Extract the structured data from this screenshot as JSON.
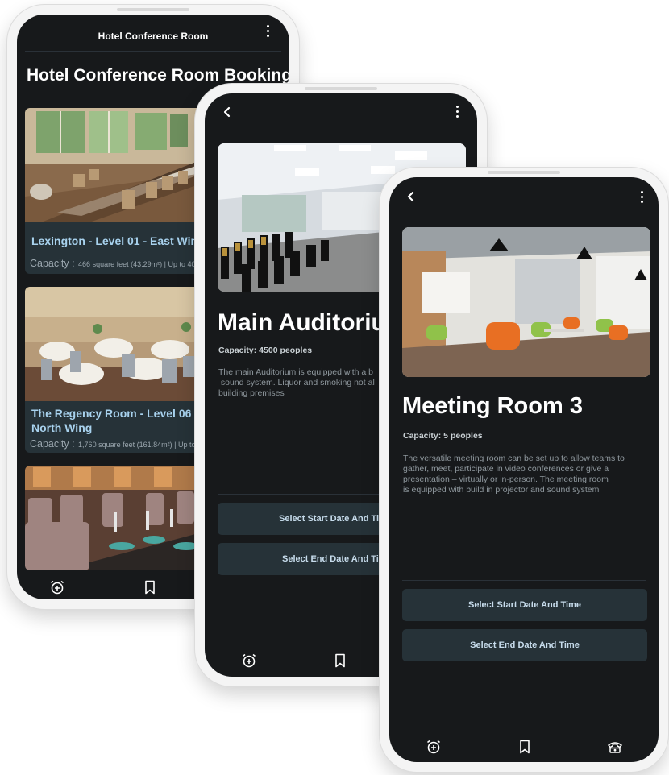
{
  "phone1": {
    "app_title": "Hotel Conference Room",
    "heading": "Hotel Conference Room Booking",
    "rooms": [
      {
        "name": "Lexington - Level 01 - East Wing",
        "capacity_label": "Capacity :",
        "capacity_value": "466 square feet (43.29m²) | Up to 40 people"
      },
      {
        "name": "The Regency Room - Level 06 - ",
        "name_line2": "North Wing",
        "capacity_label": "Capacity :",
        "capacity_value": "1,760 square feet (161.84m²) | Up to 150 people"
      }
    ]
  },
  "phone2": {
    "title": "Main Auditorium",
    "capacity": "Capacity: 4500 peoples",
    "description_lines": [
      "The main Auditorium is equipped with a b",
      " sound system. Liquor and smoking not al",
      "building premises"
    ],
    "start_button": "Select Start Date And Time",
    "end_button": "Select End Date And Time"
  },
  "phone3": {
    "title": "Meeting Room 3",
    "capacity": "Capacity: 5 peoples",
    "description_lines": [
      "The versatile meeting room can be set up to allow teams to",
      "gather, meet, participate in video conferences or give a",
      "presentation – virtually or in-person. The meeting room",
      "is equipped with build in projector and sound system"
    ],
    "start_button": "Select Start Date And Time",
    "end_button": "Select End Date And Time"
  },
  "nav_icons": [
    "alarm-add-icon",
    "bookmark-icon",
    "phone-icon"
  ],
  "colors": {
    "background": "#17191b",
    "card": "#263238",
    "accent_text": "#a8d2ee",
    "button_text": "#c7dcec"
  }
}
